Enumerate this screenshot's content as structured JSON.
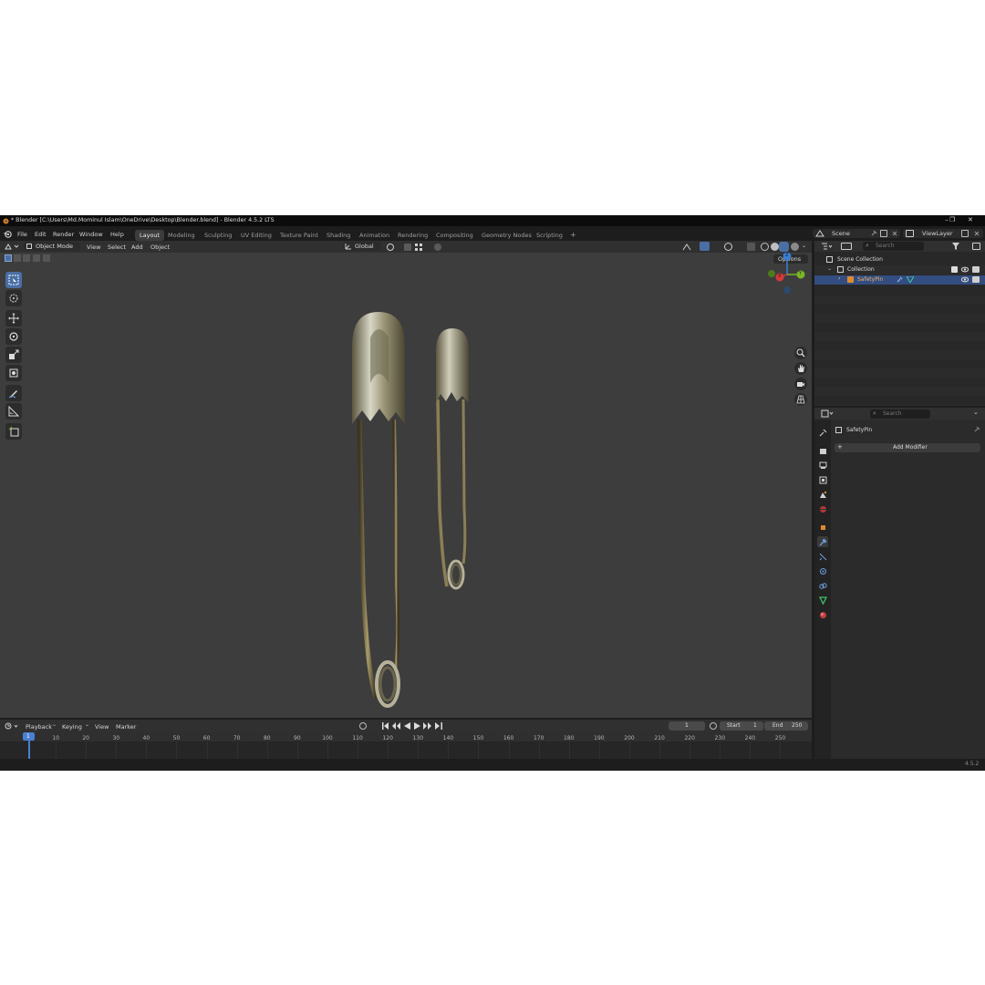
{
  "window": {
    "title": "* Blender [C:\\Users\\Md.Mominul Islam\\OneDrive\\Desktop\\Blender.blend] - Blender 4.5.2 LTS",
    "controls": [
      "–",
      "❐",
      "✕"
    ]
  },
  "menu": [
    "File",
    "Edit",
    "Render",
    "Window",
    "Help"
  ],
  "workspace_tabs": [
    "Layout",
    "Modeling",
    "Sculpting",
    "UV Editing",
    "Texture Paint",
    "Shading",
    "Animation",
    "Rendering",
    "Compositing",
    "Geometry Nodes",
    "Scripting"
  ],
  "active_workspace": "Layout",
  "add_workspace": "+",
  "scene": {
    "name": "Scene",
    "view_layer": "ViewLayer"
  },
  "viewport": {
    "mode": "Object Mode",
    "menus": [
      "View",
      "Select",
      "Add",
      "Object"
    ],
    "transform_orientation": "Global",
    "options_label": "Options",
    "gizmo": {
      "z": "Z",
      "x": "X",
      "y": "Y"
    },
    "colors": {
      "bg": "#3d3d3d",
      "x_axis": "#d43a3a",
      "y_axis": "#7ab526",
      "z_axis": "#3a7fd4"
    }
  },
  "outliner": {
    "search_placeholder": "Search",
    "scene_collection": "Scene Collection",
    "collection": "Collection",
    "object": "SafetyPin",
    "selected_color": "#334d80"
  },
  "properties": {
    "search_placeholder": "Search",
    "object_name": "SafetyPin",
    "add_modifier": "Add Modifier",
    "add_icon": "+"
  },
  "timeline": {
    "menus": [
      "Playback",
      "Keying",
      "View",
      "Marker"
    ],
    "current_frame": "1",
    "start_label": "Start",
    "start_value": "1",
    "end_label": "End",
    "end_value": "250",
    "frame_marker": "1",
    "ticks": [
      "10",
      "20",
      "30",
      "40",
      "50",
      "60",
      "70",
      "80",
      "90",
      "100",
      "110",
      "120",
      "130",
      "140",
      "150",
      "160",
      "170",
      "180",
      "190",
      "200",
      "210",
      "220",
      "230",
      "240",
      "250"
    ]
  },
  "status": {
    "version": "4.5.2"
  }
}
